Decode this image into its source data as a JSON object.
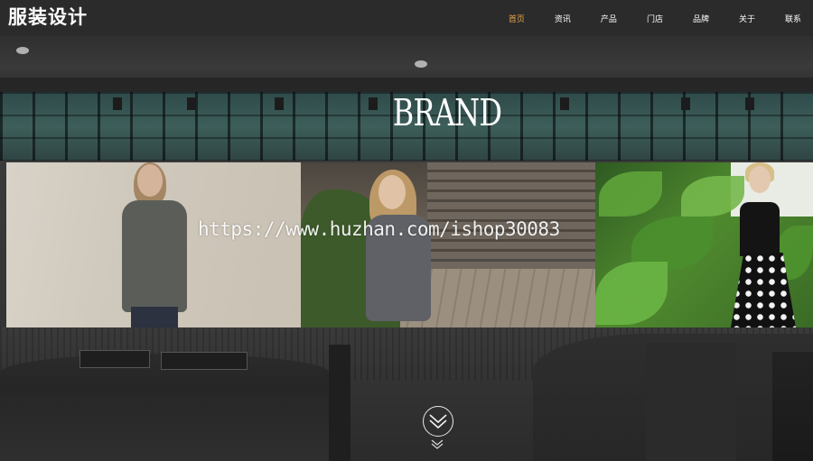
{
  "header": {
    "logo_text": "服装设计",
    "nav": [
      {
        "label": "首页",
        "active": true
      },
      {
        "label": "资讯",
        "active": false
      },
      {
        "label": "产品",
        "active": false
      },
      {
        "label": "门店",
        "active": false
      },
      {
        "label": "品牌",
        "active": false
      },
      {
        "label": "关于",
        "active": false
      },
      {
        "label": "联系",
        "active": false
      }
    ]
  },
  "hero": {
    "title": "BRAND",
    "watermark": "https://www.huzhan.com/ishop30083"
  },
  "gallery": {
    "photos": [
      "photo-grey-coat",
      "photo-grey-knit",
      "photo-polka-dot"
    ]
  },
  "icons": {
    "scroll_down": "double-chevron-down-icon"
  },
  "colors": {
    "header_bg": "#2b2b2b",
    "nav_text": "#ffffff",
    "nav_active": "#e6a54a",
    "title_text": "#ffffff"
  }
}
